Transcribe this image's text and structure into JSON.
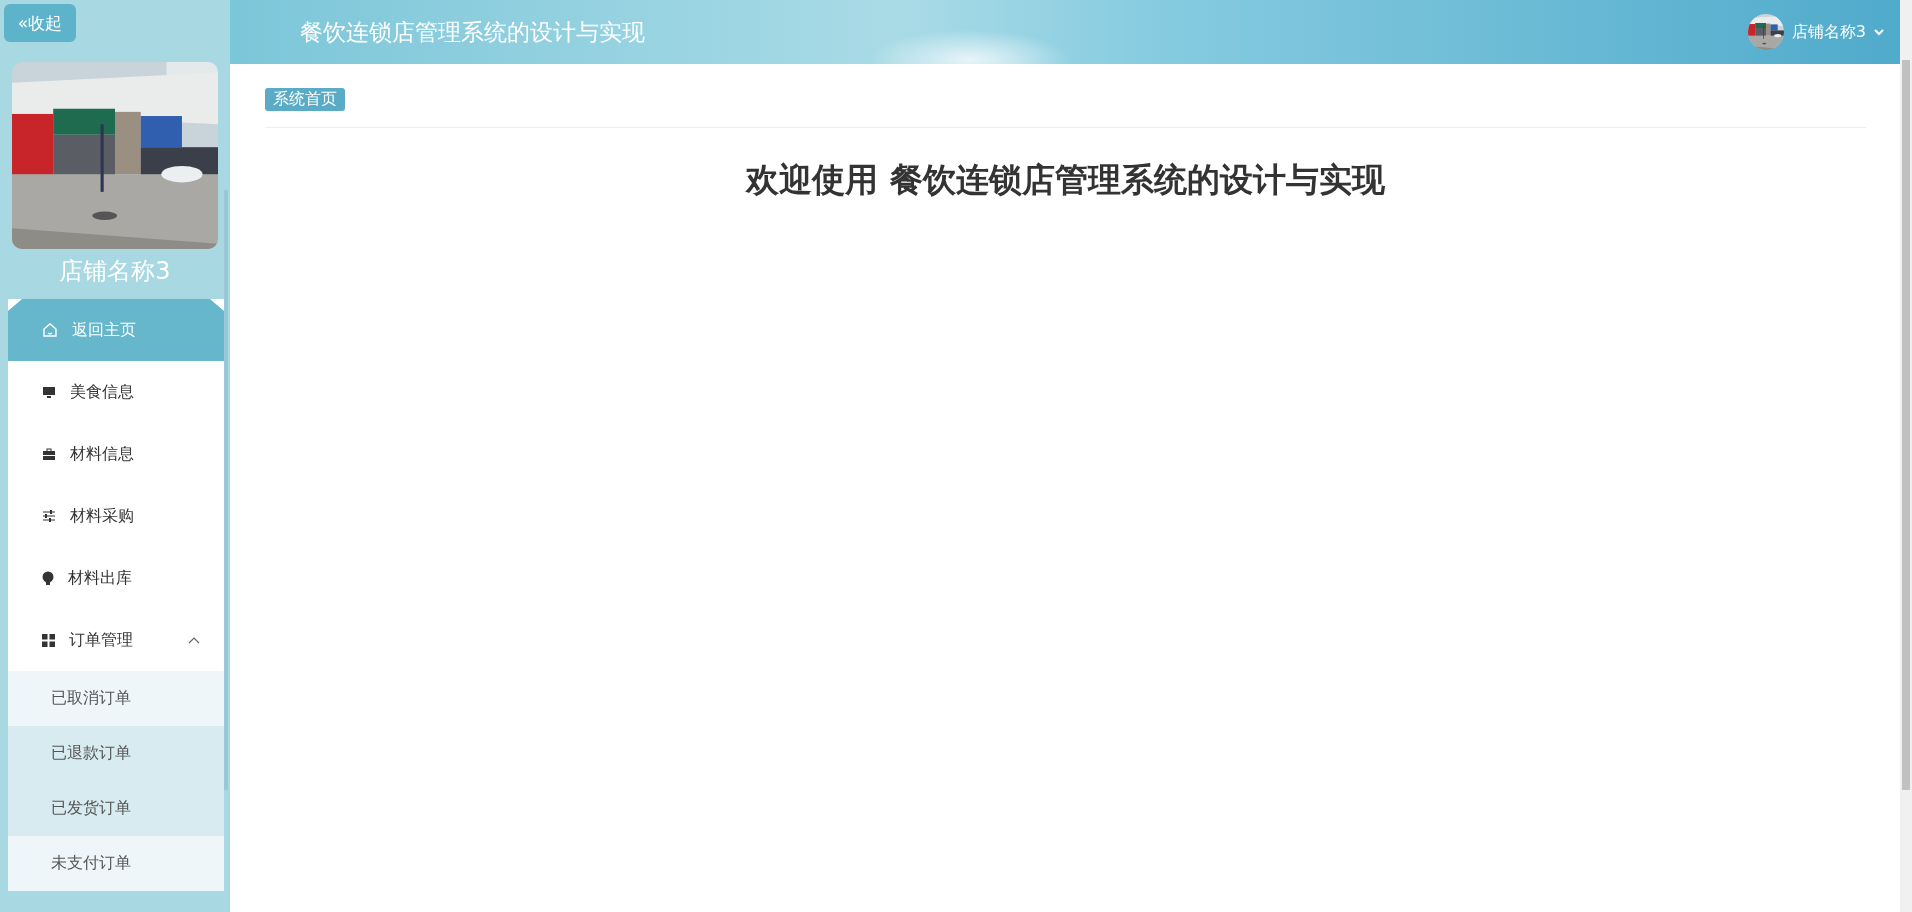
{
  "sidebar": {
    "collapse_button": {
      "icon": "«",
      "label": "收起"
    },
    "profile": {
      "name": "店铺名称3"
    },
    "menu": [
      {
        "label": "返回主页",
        "selected": true
      },
      {
        "label": "美食信息",
        "selected": false
      },
      {
        "label": "材料信息",
        "selected": false
      },
      {
        "label": "材料采购",
        "selected": false
      },
      {
        "label": "材料出库",
        "selected": false
      },
      {
        "label": "订单管理",
        "selected": false,
        "expanded": true,
        "children": [
          {
            "label": "已取消订单",
            "highlighted": false
          },
          {
            "label": "已退款订单",
            "highlighted": true
          },
          {
            "label": "已发货订单",
            "highlighted": true
          },
          {
            "label": "未支付订单",
            "highlighted": false
          }
        ]
      }
    ]
  },
  "header": {
    "title": "餐饮连锁店管理系统的设计与实现",
    "user": {
      "name": "店铺名称3"
    }
  },
  "main": {
    "breadcrumb": "系统首页",
    "welcome": "欢迎使用 餐饮连锁店管理系统的设计与实现"
  }
}
